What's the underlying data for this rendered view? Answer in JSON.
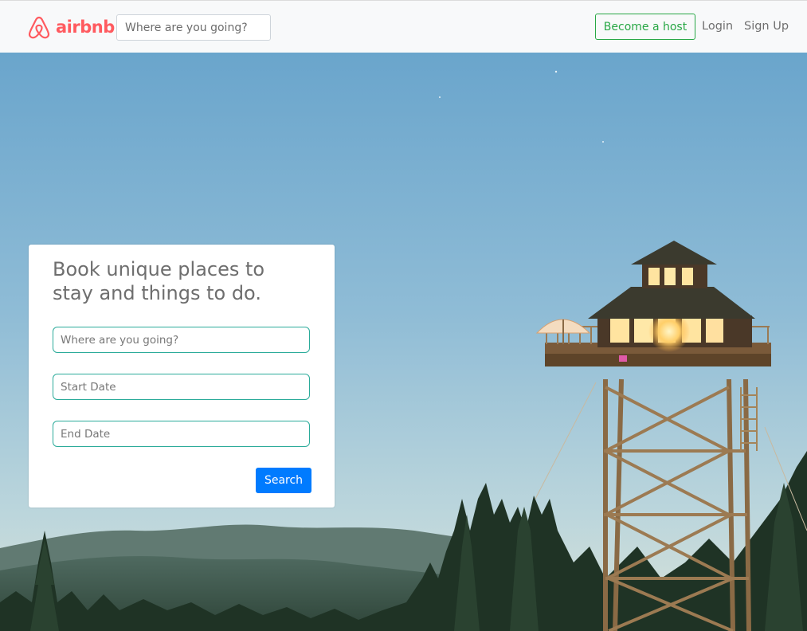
{
  "navbar": {
    "brand": "airbnb",
    "search_placeholder": "Where are you going?",
    "host_button": "Become a host",
    "login": "Login",
    "signup": "Sign Up"
  },
  "booking": {
    "title": "Book unique places to stay and things to do.",
    "where_placeholder": "Where are you going?",
    "start_placeholder": "Start Date",
    "end_placeholder": "End Date",
    "search_button": "Search"
  },
  "colors": {
    "brand": "#ff5a5f",
    "host_green": "#28a745",
    "input_border": "#2bab9a",
    "search_blue": "#007bff"
  }
}
